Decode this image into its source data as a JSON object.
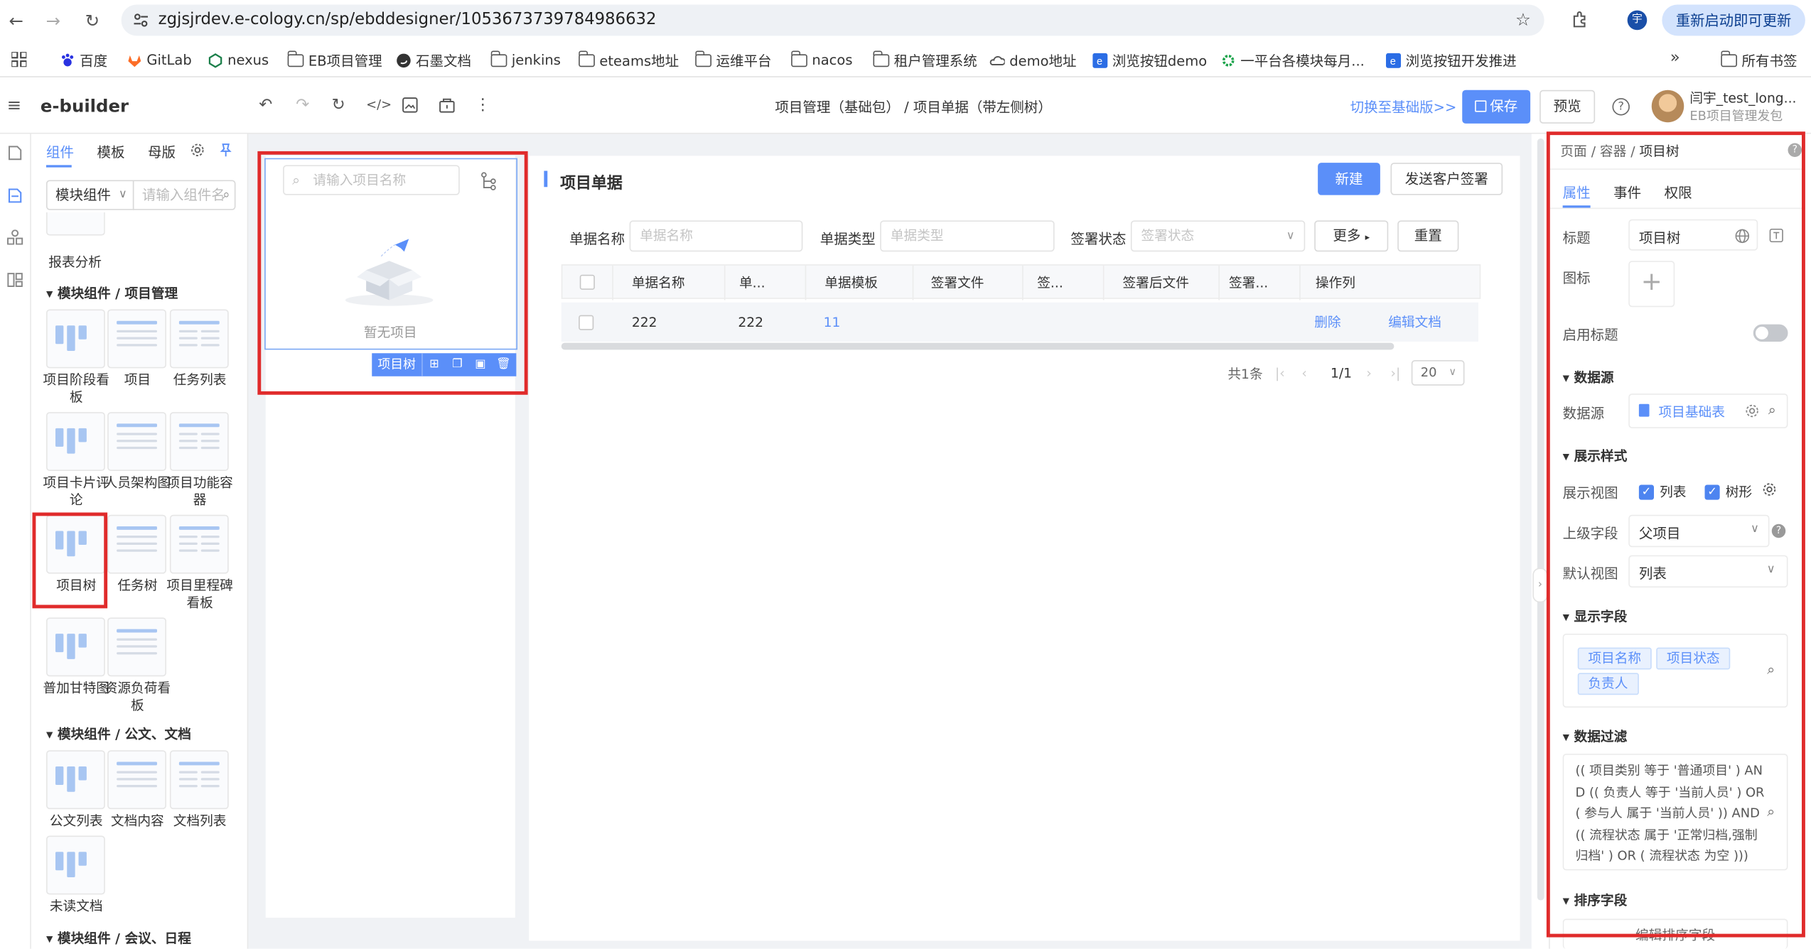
{
  "browser": {
    "url": "zgjsjrdev.e-cology.cn/sp/ebddesigner/1053673739784986632",
    "restart_label": "重新启动即可更新",
    "profile_initial": "宇",
    "bookmarks": [
      {
        "label": "百度",
        "icon": "baidu-icon"
      },
      {
        "label": "GitLab",
        "icon": "gitlab-icon"
      },
      {
        "label": "nexus",
        "icon": "nexus-icon"
      },
      {
        "label": "EB项目管理",
        "icon": "folder-icon"
      },
      {
        "label": "石墨文档",
        "icon": "shimo-icon"
      },
      {
        "label": "jenkins",
        "icon": "folder-icon"
      },
      {
        "label": "eteams地址",
        "icon": "folder-icon"
      },
      {
        "label": "运维平台",
        "icon": "folder-icon"
      },
      {
        "label": "nacos",
        "icon": "folder-icon"
      },
      {
        "label": "租户管理系统",
        "icon": "folder-icon"
      },
      {
        "label": "demo地址",
        "icon": "cloud-icon"
      },
      {
        "label": "浏览按钮demo",
        "icon": "e-icon"
      },
      {
        "label": "一平台各模块每月...",
        "icon": "gear-green-icon"
      },
      {
        "label": "浏览按钮开发推进",
        "icon": "e-icon"
      }
    ],
    "all_bookmarks": "所有书签",
    "more_bookmarks": "»"
  },
  "app": {
    "logo": "e-builder",
    "breadcrumb": "项目管理（基础包） / 项目单据（带左侧树）",
    "switch_label": "切换至基础版>>",
    "save_label": "保存",
    "preview_label": "预览",
    "help_icon": "?",
    "user_name": "闫宇_test_long...",
    "user_sub": "EB项目管理发包"
  },
  "left_panel": {
    "tabs": [
      "组件",
      "模板",
      "母版"
    ],
    "module_select": "模块组件",
    "search_placeholder": "请输入组件名",
    "top_item": "报表分析",
    "sections": [
      {
        "title": "模块组件 / 项目管理",
        "items": [
          "项目阶段看板",
          "项目",
          "任务列表",
          "项目卡片评论",
          "人员架构图",
          "项目功能容器",
          "项目树",
          "任务树",
          "项目里程碑看板",
          "普加甘特图",
          "资源负荷看板"
        ]
      },
      {
        "title": "模块组件 / 公文、文档",
        "items": [
          "公文列表",
          "文档内容",
          "文档列表",
          "未读文档"
        ]
      },
      {
        "title": "模块组件 / 会议、日程",
        "items": []
      }
    ]
  },
  "tree_widget": {
    "search_placeholder": "请输入项目名称",
    "empty_text": "暂无项目",
    "toolbar_label": "项目树"
  },
  "main": {
    "title": "项目单据",
    "new_button": "新建",
    "send_button": "发送客户签署",
    "filters": [
      {
        "label": "单据名称",
        "placeholder": "单据名称"
      },
      {
        "label": "单据类型",
        "placeholder": "单据类型"
      },
      {
        "label": "签署状态",
        "placeholder": "签署状态"
      }
    ],
    "more_label": "更多",
    "reset_label": "重置",
    "columns": [
      "单据名称",
      "单...",
      "单据模板",
      "签署文件",
      "签...",
      "签署后文件",
      "签署...",
      "操作列"
    ],
    "rows": [
      {
        "name": "222",
        "code": "222",
        "template": "11",
        "actions": [
          "删除",
          "编辑文档"
        ]
      }
    ],
    "pagination": {
      "total": "共1条",
      "page": "1/1",
      "size": "20"
    }
  },
  "props": {
    "crumb_parts": [
      "页面",
      "容器",
      "项目树"
    ],
    "tabs": [
      "属性",
      "事件",
      "权限"
    ],
    "title_label": "标题",
    "title_value": "项目树",
    "icon_label": "图标",
    "enable_title_label": "启用标题",
    "enable_title_on": false,
    "datasource_section": "数据源",
    "datasource_label": "数据源",
    "datasource_value": "项目基础表",
    "display_section": "展示样式",
    "view_label": "展示视图",
    "view_options": [
      "列表",
      "树形"
    ],
    "parent_label": "上级字段",
    "parent_value": "父项目",
    "default_view_label": "默认视图",
    "default_view_value": "列表",
    "fields_section": "显示字段",
    "fields": [
      "项目名称",
      "项目状态",
      "负责人"
    ],
    "filter_section": "数据过滤",
    "filter_text": "(( 项目类别 等于 '普通项目' ) AND (( 负责人 等于 '当前人员' ) OR ( 参与人 属于 '当前人员' )) AND (( 流程状态 属于 '正常归档,强制归档' ) OR ( 流程状态 为空 )))",
    "sort_section": "排序字段",
    "sort_button": "编辑排序字段"
  },
  "colors": {
    "primary": "#5b8ff9",
    "highlight_red": "#e02b2b"
  }
}
